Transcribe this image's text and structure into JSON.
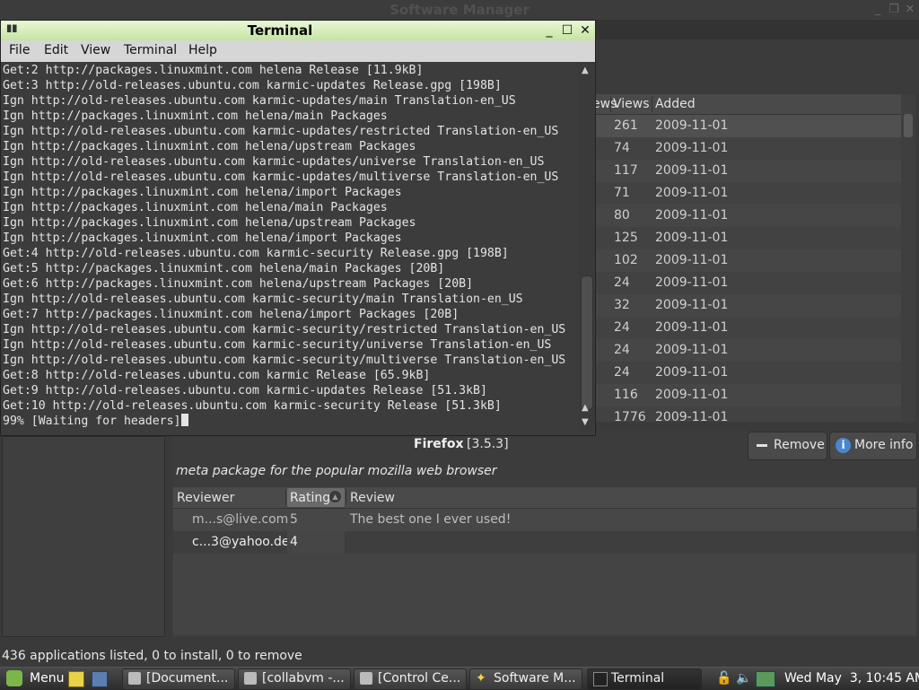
{
  "software_manager": {
    "title": "Software Manager",
    "columns": [
      "ews",
      "Views",
      "Added"
    ],
    "apps": [
      {
        "views": "261",
        "added": "2009-11-01"
      },
      {
        "views": "74",
        "added": "2009-11-01"
      },
      {
        "views": "117",
        "added": "2009-11-01"
      },
      {
        "views": "71",
        "added": "2009-11-01"
      },
      {
        "views": "80",
        "added": "2009-11-01"
      },
      {
        "views": "125",
        "added": "2009-11-01"
      },
      {
        "views": "102",
        "added": "2009-11-01"
      },
      {
        "views": "24",
        "added": "2009-11-01"
      },
      {
        "views": "32",
        "added": "2009-11-01"
      },
      {
        "views": "24",
        "added": "2009-11-01"
      },
      {
        "views": "24",
        "added": "2009-11-01"
      },
      {
        "views": "24",
        "added": "2009-11-01"
      },
      {
        "views": "116",
        "added": "2009-11-01"
      },
      {
        "views": "1776",
        "added": "2009-11-01"
      }
    ],
    "package": {
      "name": "Firefox",
      "version": "[3.5.3]",
      "description": "meta package for the popular mozilla web browser",
      "remove_label": "Remove",
      "more_info_label": "More info"
    },
    "reviews": {
      "headers": {
        "reviewer": "Reviewer",
        "rating": "Rating",
        "review": "Review"
      },
      "rows": [
        {
          "reviewer": "m...s@live.com",
          "rating": "5",
          "review": "The best one I ever used!"
        },
        {
          "reviewer": "c...3@yahoo.de",
          "rating": "4",
          "review": ""
        }
      ]
    },
    "status": "436 applications listed, 0 to install, 0 to remove"
  },
  "terminal": {
    "title": "Terminal",
    "menu": [
      "File",
      "Edit",
      "View",
      "Terminal",
      "Help"
    ],
    "lines": [
      "Get:2 http://packages.linuxmint.com helena Release [11.9kB]",
      "Get:3 http://old-releases.ubuntu.com karmic-updates Release.gpg [198B]",
      "Ign http://old-releases.ubuntu.com karmic-updates/main Translation-en_US",
      "Ign http://packages.linuxmint.com helena/main Packages",
      "Ign http://old-releases.ubuntu.com karmic-updates/restricted Translation-en_US",
      "Ign http://packages.linuxmint.com helena/upstream Packages",
      "Ign http://old-releases.ubuntu.com karmic-updates/universe Translation-en_US",
      "Ign http://old-releases.ubuntu.com karmic-updates/multiverse Translation-en_US",
      "Ign http://packages.linuxmint.com helena/import Packages",
      "Ign http://packages.linuxmint.com helena/main Packages",
      "Ign http://packages.linuxmint.com helena/upstream Packages",
      "Ign http://packages.linuxmint.com helena/import Packages",
      "Get:4 http://old-releases.ubuntu.com karmic-security Release.gpg [198B]",
      "Get:5 http://packages.linuxmint.com helena/main Packages [20B]",
      "Get:6 http://packages.linuxmint.com helena/upstream Packages [20B]",
      "Ign http://old-releases.ubuntu.com karmic-security/main Translation-en_US",
      "Get:7 http://packages.linuxmint.com helena/import Packages [20B]",
      "Ign http://old-releases.ubuntu.com karmic-security/restricted Translation-en_US",
      "Ign http://old-releases.ubuntu.com karmic-security/universe Translation-en_US",
      "Ign http://old-releases.ubuntu.com karmic-security/multiverse Translation-en_US",
      "Get:8 http://old-releases.ubuntu.com karmic Release [65.9kB]",
      "Get:9 http://old-releases.ubuntu.com karmic-updates Release [51.3kB]",
      "Get:10 http://old-releases.ubuntu.com karmic-security Release [51.3kB]"
    ],
    "prompt_line": "99% [Waiting for headers]"
  },
  "taskbar": {
    "menu_label": "Menu",
    "tasks": [
      "[Document...",
      "[collabvm -...",
      "[Control Ce...",
      "Software M...",
      "Terminal"
    ],
    "clock": "Wed May  3, 10:45 AM"
  },
  "colors": {
    "terminal_titlebar": "#d4ebb5",
    "mint_green": "#7ab648"
  }
}
